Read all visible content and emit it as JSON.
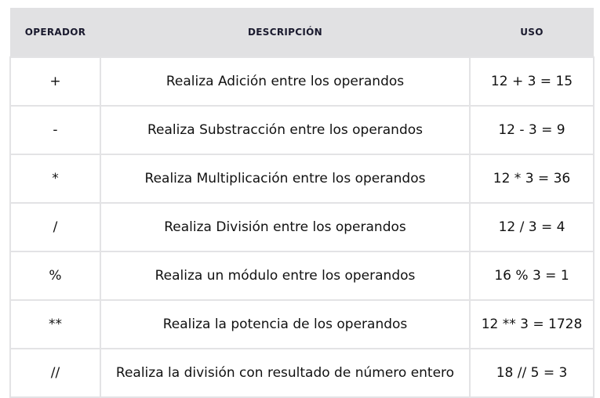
{
  "headers": {
    "operator": "OPERADOR",
    "description": "DESCRIPCIÓN",
    "usage": "USO"
  },
  "rows": [
    {
      "operator": "+",
      "description": "Realiza Adición entre los operandos",
      "usage": "12 + 3 = 15"
    },
    {
      "operator": "-",
      "description": "Realiza Substracción entre los operandos",
      "usage": "12 - 3 = 9"
    },
    {
      "operator": "*",
      "description": "Realiza Multiplicación entre los operandos",
      "usage": "12 * 3 = 36"
    },
    {
      "operator": "/",
      "description": "Realiza División entre los operandos",
      "usage": "12 / 3 = 4"
    },
    {
      "operator": "%",
      "description": "Realiza un módulo entre los operandos",
      "usage": "16 % 3 = 1"
    },
    {
      "operator": "**",
      "description": "Realiza la potencia de los operandos",
      "usage": "12 ** 3 = 1728"
    },
    {
      "operator": "//",
      "description": "Realiza la división con resultado de número entero",
      "usage": "18 // 5 = 3"
    }
  ]
}
